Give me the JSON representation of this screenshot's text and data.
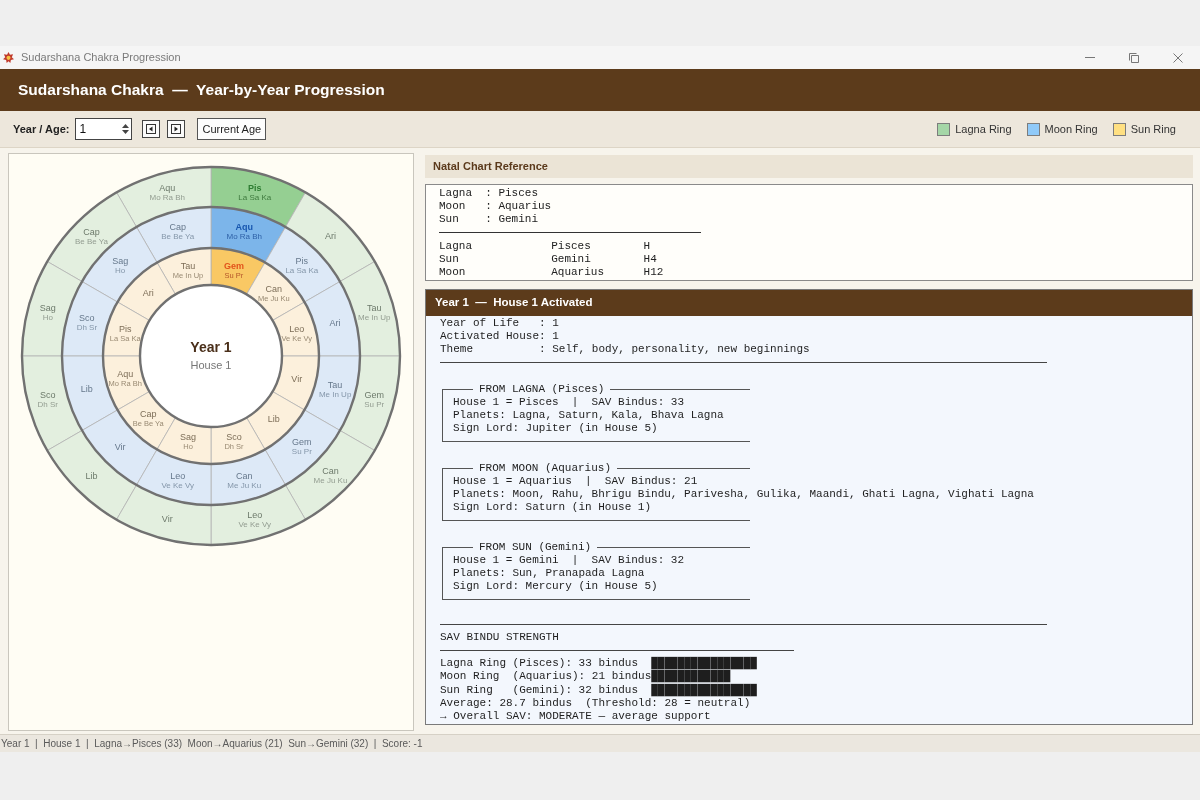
{
  "window": {
    "title": "Sudarshana Chakra Progression"
  },
  "header": {
    "title": "Sudarshana Chakra  —  Year-by-Year Progression"
  },
  "toolbar": {
    "label": "Year / Age:",
    "year_field": {
      "value": "1"
    },
    "buttons": [
      {
        "kind": "prev"
      },
      {
        "kind": "next"
      },
      {
        "kind": "text",
        "label": "Current Age"
      }
    ]
  },
  "legend": [
    {
      "label": "Lagna Ring",
      "color": "#a5d6a7"
    },
    {
      "label": "Moon Ring",
      "color": "#90caf9"
    },
    {
      "label": "Sun Ring",
      "color": "#ffe082"
    }
  ],
  "wheel": {
    "center": {
      "title": "Year 1",
      "subtitle": "House 1"
    },
    "rings": [
      {
        "kind": "lagna",
        "left": [
          {
            "sign": "Aqu",
            "planets": "Mo Ra Bh",
            "active": false
          },
          {
            "sign": "Cap",
            "planets": "Be Be Ya",
            "active": false
          },
          {
            "sign": "Sag",
            "planets": "Ho",
            "active": false
          },
          {
            "sign": "Sco",
            "planets": "Dh Sr",
            "active": false
          },
          {
            "sign": "Lib",
            "active": false
          },
          {
            "sign": "Vir",
            "active": false
          }
        ],
        "right": [
          {
            "sign": "Pis",
            "planets": "La Sa Ka",
            "active": true
          },
          {
            "sign": "Ari",
            "active": false
          },
          {
            "sign": "Tau",
            "planets": "Me In Up",
            "active": false
          },
          {
            "sign": "Gem",
            "planets": "Su Pr",
            "active": false
          },
          {
            "sign": "Can",
            "planets": "Me Ju Ku",
            "active": false
          },
          {
            "sign": "Leo",
            "planets": "Ve Ke Vy",
            "active": false
          }
        ]
      },
      {
        "kind": "moon",
        "left": [
          {
            "sign": "Cap",
            "planets": "Be Be Ya",
            "active": false
          },
          {
            "sign": "Sag",
            "planets": "Ho",
            "active": false
          },
          {
            "sign": "Sco",
            "planets": "Dh Sr",
            "active": false
          },
          {
            "sign": "Lib",
            "active": false
          },
          {
            "sign": "Vir",
            "active": false
          },
          {
            "sign": "Leo",
            "planets": "Ve Ke Vy",
            "active": false
          }
        ],
        "right": [
          {
            "sign": "Aqu",
            "planets": "Mo Ra Bh",
            "active": true
          },
          {
            "sign": "Pis",
            "planets": "La Sa Ka",
            "active": false
          },
          {
            "sign": "Ari",
            "active": false
          },
          {
            "sign": "Tau",
            "planets": "Me In Up",
            "active": false
          },
          {
            "sign": "Gem",
            "planets": "Su Pr",
            "active": false
          },
          {
            "sign": "Can",
            "planets": "Me Ju Ku",
            "active": false
          }
        ]
      },
      {
        "kind": "sun",
        "left": [
          {
            "sign": "Tau",
            "planets": "Me In Up",
            "active": false
          },
          {
            "sign": "Ari",
            "active": false
          },
          {
            "sign": "Pis",
            "planets": "La Sa Ka",
            "active": false
          },
          {
            "sign": "Aqu",
            "planets": "Mo Ra Bh",
            "active": false
          },
          {
            "sign": "Cap",
            "planets": "Be Be Ya",
            "active": false
          },
          {
            "sign": "Sag",
            "planets": "Ho",
            "active": false
          }
        ],
        "right": [
          {
            "sign": "Gem",
            "planets": "Su Pr",
            "active": true
          },
          {
            "sign": "Can",
            "planets": "Me Ju Ku",
            "active": false
          },
          {
            "sign": "Leo",
            "planets": "Ve Ke Vy",
            "active": false
          },
          {
            "sign": "Vir",
            "active": false
          },
          {
            "sign": "Lib",
            "active": false
          },
          {
            "sign": "Sco",
            "planets": "Dh Sr",
            "active": false
          }
        ]
      }
    ]
  },
  "natal": {
    "title": "Natal Chart Reference",
    "summary": [
      "Lagna  : Pisces",
      "Moon   : Aquarius",
      "Sun    : Gemini"
    ],
    "rows": [
      {
        "body": "Lagna",
        "sign": "Pisces",
        "house": "H"
      },
      {
        "body": "Sun",
        "sign": "Gemini",
        "house": "H4"
      },
      {
        "body": "Moon",
        "sign": "Aquarius",
        "house": "H12"
      }
    ]
  },
  "year_panel": {
    "title": "Year 1  —  House 1 Activated",
    "info": [
      "Year of Life   : 1",
      "Activated House: 1",
      "Theme          : Self, body, personality, new beginnings"
    ],
    "sections": [
      {
        "title": "FROM LAGNA (Pisces)",
        "lines": [
          "House 1 = Pisces  |  SAV Bindus: 33",
          "Planets: Lagna, Saturn, Kala, Bhava Lagna",
          "Sign Lord: Jupiter (in House 5)"
        ]
      },
      {
        "title": "FROM MOON (Aquarius)",
        "lines": [
          "House 1 = Aquarius  |  SAV Bindus: 21",
          "Planets: Moon, Rahu, Bhrigu Bindu, Parivesha, Gulika, Maandi, Ghati Lagna, Vighati Lagna",
          "Sign Lord: Saturn (in House 1)"
        ]
      },
      {
        "title": "FROM SUN (Gemini)",
        "lines": [
          "House 1 = Gemini  |  SAV Bindus: 32",
          "Planets: Sun, Pranapada Lagna",
          "Sign Lord: Mercury (in House 5)"
        ]
      }
    ],
    "strength": {
      "title": "SAV BINDU STRENGTH",
      "lines": [
        "Lagna Ring (Pisces): 33 bindus  ████████████████",
        "Moon Ring  (Aquarius): 21 bindus████████████",
        "Sun Ring   (Gemini): 32 bindus  ████████████████",
        "Average: 28.7 bindus  (Threshold: 28 = neutral)",
        "→ Overall SAV: MODERATE — average support"
      ]
    }
  },
  "status_bar": {
    "text": "Year 1  |  House 1  |  Lagna→Pisces (33)  Moon→Aquarius (21)  Sun→Gemini (32)  |  Score: -1"
  }
}
